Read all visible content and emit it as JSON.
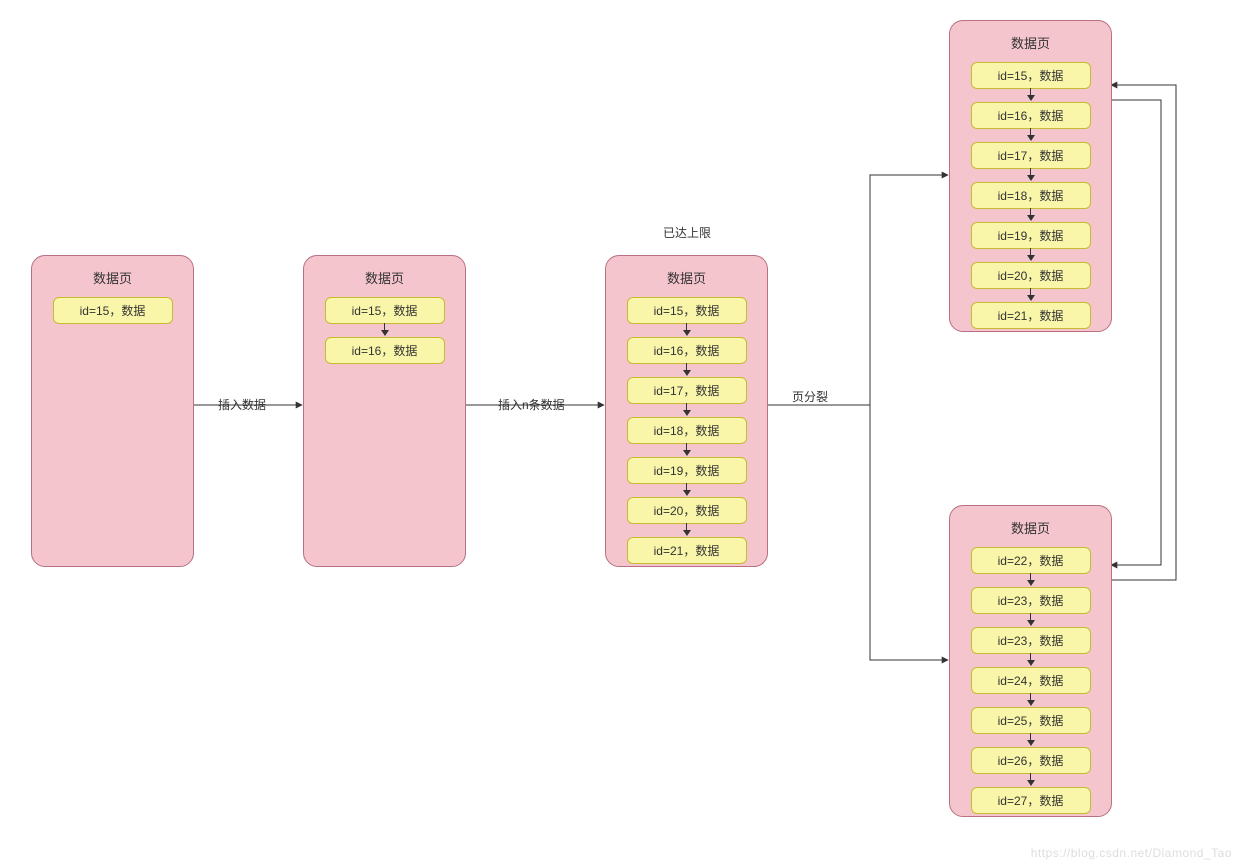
{
  "labels": {
    "page_title": "数据页",
    "insert_data": "插入数据",
    "insert_n": "插入n条数据",
    "limit_reached": "已达上限",
    "page_split": "页分裂",
    "watermark": "https://blog.csdn.net/Diamond_Tao"
  },
  "pages": {
    "p1": {
      "records": [
        "id=15，数据"
      ]
    },
    "p2": {
      "records": [
        "id=15，数据",
        "id=16，数据"
      ]
    },
    "p3": {
      "records": [
        "id=15，数据",
        "id=16，数据",
        "id=17，数据",
        "id=18，数据",
        "id=19，数据",
        "id=20，数据",
        "id=21，数据"
      ]
    },
    "p4": {
      "records": [
        "id=15，数据",
        "id=16，数据",
        "id=17，数据",
        "id=18，数据",
        "id=19，数据",
        "id=20，数据",
        "id=21，数据"
      ]
    },
    "p5": {
      "records": [
        "id=22，数据",
        "id=23，数据",
        "id=23，数据",
        "id=24，数据",
        "id=25，数据",
        "id=26，数据",
        "id=27，数据"
      ]
    }
  },
  "chart_data": {
    "type": "diagram",
    "title": "",
    "nodes": [
      {
        "id": "p1",
        "label": "数据页",
        "records": [
          "id=15，数据"
        ]
      },
      {
        "id": "p2",
        "label": "数据页",
        "records": [
          "id=15，数据",
          "id=16，数据"
        ]
      },
      {
        "id": "p3",
        "label": "数据页",
        "records": [
          "id=15，数据",
          "id=16，数据",
          "id=17，数据",
          "id=18，数据",
          "id=19，数据",
          "id=20，数据",
          "id=21，数据"
        ],
        "note": "已达上限"
      },
      {
        "id": "p4",
        "label": "数据页",
        "records": [
          "id=15，数据",
          "id=16，数据",
          "id=17，数据",
          "id=18，数据",
          "id=19，数据",
          "id=20，数据",
          "id=21，数据"
        ]
      },
      {
        "id": "p5",
        "label": "数据页",
        "records": [
          "id=22，数据",
          "id=23，数据",
          "id=23，数据",
          "id=24，数据",
          "id=25，数据",
          "id=26，数据",
          "id=27，数据"
        ]
      }
    ],
    "edges": [
      {
        "from": "p1",
        "to": "p2",
        "label": "插入数据"
      },
      {
        "from": "p2",
        "to": "p3",
        "label": "插入n条数据"
      },
      {
        "from": "p3",
        "to": "p4",
        "label": "页分裂"
      },
      {
        "from": "p3",
        "to": "p5",
        "label": "页分裂"
      },
      {
        "from": "p4",
        "to": "p5",
        "label": "",
        "bidirectional": true
      }
    ]
  }
}
